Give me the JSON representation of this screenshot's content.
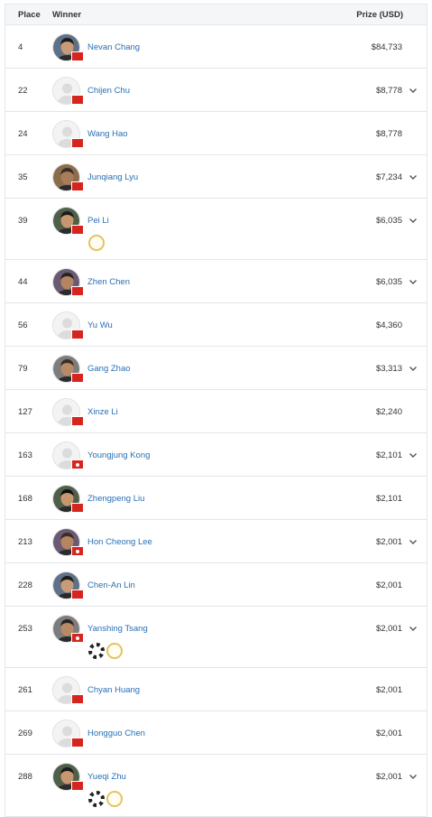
{
  "header": {
    "place": "Place",
    "winner": "Winner",
    "prize": "Prize (USD)"
  },
  "colors": {
    "link": "#2870b4",
    "flag_red": "#d6241e",
    "border": "#e3e6ea"
  },
  "rows": [
    {
      "place": "4",
      "name": "Nevan Chang",
      "prize": "$84,733",
      "expand": false,
      "flag": "cn",
      "photo": true,
      "badges": []
    },
    {
      "place": "22",
      "name": "Chijen Chu",
      "prize": "$8,778",
      "expand": true,
      "flag": "cn",
      "photo": false,
      "badges": []
    },
    {
      "place": "24",
      "name": "Wang Hao",
      "prize": "$8,778",
      "expand": false,
      "flag": "cn",
      "photo": false,
      "badges": []
    },
    {
      "place": "35",
      "name": "Junqiang Lyu",
      "prize": "$7,234",
      "expand": true,
      "flag": "cn",
      "photo": true,
      "badges": []
    },
    {
      "place": "39",
      "name": "Pei Li",
      "prize": "$6,035",
      "expand": true,
      "flag": "cn",
      "photo": true,
      "badges": [
        "gold-ring"
      ]
    },
    {
      "place": "44",
      "name": "Zhen Chen",
      "prize": "$6,035",
      "expand": true,
      "flag": "cn",
      "photo": true,
      "badges": []
    },
    {
      "place": "56",
      "name": "Yu Wu",
      "prize": "$4,360",
      "expand": false,
      "flag": "cn",
      "photo": false,
      "badges": []
    },
    {
      "place": "79",
      "name": "Gang Zhao",
      "prize": "$3,313",
      "expand": true,
      "flag": "cn",
      "photo": true,
      "badges": []
    },
    {
      "place": "127",
      "name": "Xinze Li",
      "prize": "$2,240",
      "expand": false,
      "flag": "cn",
      "photo": false,
      "badges": []
    },
    {
      "place": "163",
      "name": "Youngjung Kong",
      "prize": "$2,101",
      "expand": true,
      "flag": "hk",
      "photo": false,
      "badges": []
    },
    {
      "place": "168",
      "name": "Zhengpeng Liu",
      "prize": "$2,101",
      "expand": false,
      "flag": "cn",
      "photo": true,
      "badges": []
    },
    {
      "place": "213",
      "name": "Hon Cheong Lee",
      "prize": "$2,001",
      "expand": true,
      "flag": "hk",
      "photo": true,
      "badges": []
    },
    {
      "place": "228",
      "name": "Chen-An Lin",
      "prize": "$2,001",
      "expand": false,
      "flag": "cn",
      "photo": true,
      "badges": []
    },
    {
      "place": "253",
      "name": "Yanshing Tsang",
      "prize": "$2,001",
      "expand": true,
      "flag": "hk",
      "photo": true,
      "badges": [
        "chip",
        "gold-ring"
      ]
    },
    {
      "place": "261",
      "name": "Chyan Huang",
      "prize": "$2,001",
      "expand": false,
      "flag": "cn",
      "photo": false,
      "badges": []
    },
    {
      "place": "269",
      "name": "Hongguo Chen",
      "prize": "$2,001",
      "expand": false,
      "flag": "cn",
      "photo": false,
      "badges": []
    },
    {
      "place": "288",
      "name": "Yueqi Zhu",
      "prize": "$2,001",
      "expand": true,
      "flag": "cn",
      "photo": true,
      "badges": [
        "chip",
        "gold-ring"
      ]
    }
  ]
}
